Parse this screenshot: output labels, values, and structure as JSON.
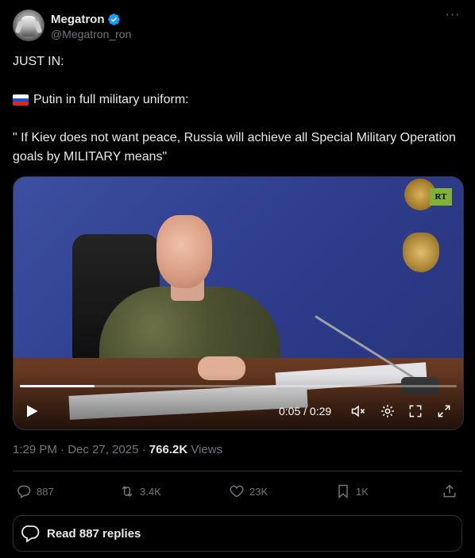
{
  "author": {
    "display_name": "Megatron",
    "handle": "@Megatron_ron",
    "verified": true
  },
  "tweet": {
    "line_1": "JUST IN:",
    "line_2": "Putin in full military uniform:",
    "line_3": "\" If Kiev does not want peace, Russia will achieve all Special Military Operation goals by MILITARY means\"",
    "flag": "russia-flag"
  },
  "video": {
    "channel_logo": "RT",
    "time_display": "0:05 / 0:29",
    "progress": 0.17
  },
  "meta": {
    "time": "1:29 PM",
    "separator_1": " · ",
    "date": "Dec 27, 2025",
    "separator_2": " · ",
    "views_count": "766.2K",
    "views_label": " Views"
  },
  "actions": {
    "replies": "887",
    "reposts": "3.4K",
    "likes": "23K",
    "bookmarks": "1K"
  },
  "read_replies": {
    "label": "Read 887 replies"
  },
  "colors": {
    "background": "#000000",
    "text": "#e7e9ea",
    "muted": "#71767b",
    "verified": "#1d9bf0",
    "border": "#2f3336"
  }
}
